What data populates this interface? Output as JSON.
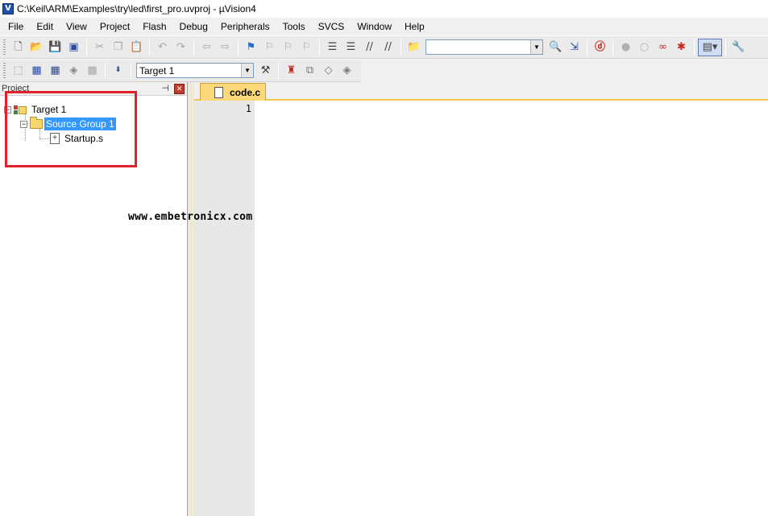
{
  "window": {
    "title": "C:\\Keil\\ARM\\Examples\\try\\led\\first_pro.uvproj - µVision4",
    "app_icon_glyph": "V"
  },
  "menu": {
    "items": [
      "File",
      "Edit",
      "View",
      "Project",
      "Flash",
      "Debug",
      "Peripherals",
      "Tools",
      "SVCS",
      "Window",
      "Help"
    ]
  },
  "toolbar": {
    "find_combo_value": "",
    "target_select_value": "Target 1",
    "icons_row1": [
      "new-file-icon",
      "open-file-icon",
      "save-icon",
      "save-all-icon",
      "cut-icon",
      "copy-icon",
      "paste-icon",
      "undo-icon",
      "redo-icon",
      "navigate-back-icon",
      "navigate-forward-icon",
      "bookmark-icon",
      "prev-bookmark-icon",
      "next-bookmark-icon",
      "clear-bookmarks-icon",
      "indent-icon",
      "unindent-icon",
      "comment-icon",
      "uncomment-icon",
      "find-in-files-icon",
      "find-icon",
      "incremental-find-icon",
      "debug-session-icon",
      "breakpoint-icon",
      "disable-breakpoint-icon",
      "disable-all-breakpoints-icon",
      "kill-all-breakpoints-icon",
      "window-layout-icon",
      "configure-icon"
    ],
    "icons_row2": [
      "translate-icon",
      "build-icon",
      "rebuild-icon",
      "batch-build-icon",
      "stop-build-icon",
      "download-icon",
      "target-options-icon",
      "file-extensions-icon",
      "manage-components-icon",
      "select-device-icon",
      "pack-installer-icon"
    ]
  },
  "project_panel": {
    "title": "Project",
    "tree": {
      "target": "Target 1",
      "group": "Source Group 1",
      "file": "Startup.s"
    }
  },
  "editor": {
    "tab_label": "code.c",
    "line_numbers": [
      "1"
    ],
    "code": ""
  },
  "watermark": "www.embetronicx.com",
  "colors": {
    "selection": "#3399ff",
    "annotation_border": "#e0202a",
    "active_tab": "#fbd97a",
    "gutter": "#e8e8e8"
  }
}
